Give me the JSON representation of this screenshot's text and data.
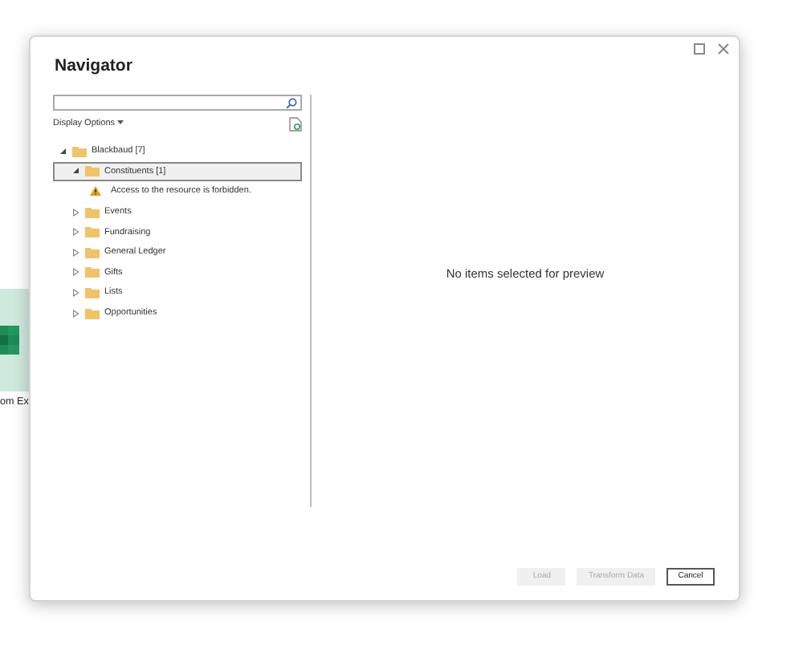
{
  "background_tile": {
    "caption": "om Ex"
  },
  "dialog": {
    "title": "Navigator",
    "display_options": "Display Options",
    "tree": [
      {
        "kind": "folder",
        "label": "Blackbaud [7]",
        "expanded": true,
        "selected": false,
        "children": [
          {
            "kind": "folder",
            "label": "Constituents [1]",
            "expanded": true,
            "selected": true,
            "children": [
              {
                "kind": "message",
                "label": "Access to the resource is forbidden."
              }
            ]
          },
          {
            "kind": "folder",
            "label": "Events",
            "expanded": false,
            "selected": false
          },
          {
            "kind": "folder",
            "label": "Fundraising",
            "expanded": false,
            "selected": false
          },
          {
            "kind": "folder",
            "label": "General Ledger",
            "expanded": false,
            "selected": false
          },
          {
            "kind": "folder",
            "label": "Gifts",
            "expanded": false,
            "selected": false
          },
          {
            "kind": "folder",
            "label": "Lists",
            "expanded": false,
            "selected": false
          },
          {
            "kind": "folder",
            "label": "Opportunities",
            "expanded": false,
            "selected": false
          }
        ]
      }
    ],
    "preview_message": "No items selected for preview",
    "buttons": [
      {
        "label": "Load",
        "disabled": true
      },
      {
        "label": "Transform Data",
        "disabled": true
      },
      {
        "label": "Cancel",
        "disabled": false
      }
    ]
  }
}
